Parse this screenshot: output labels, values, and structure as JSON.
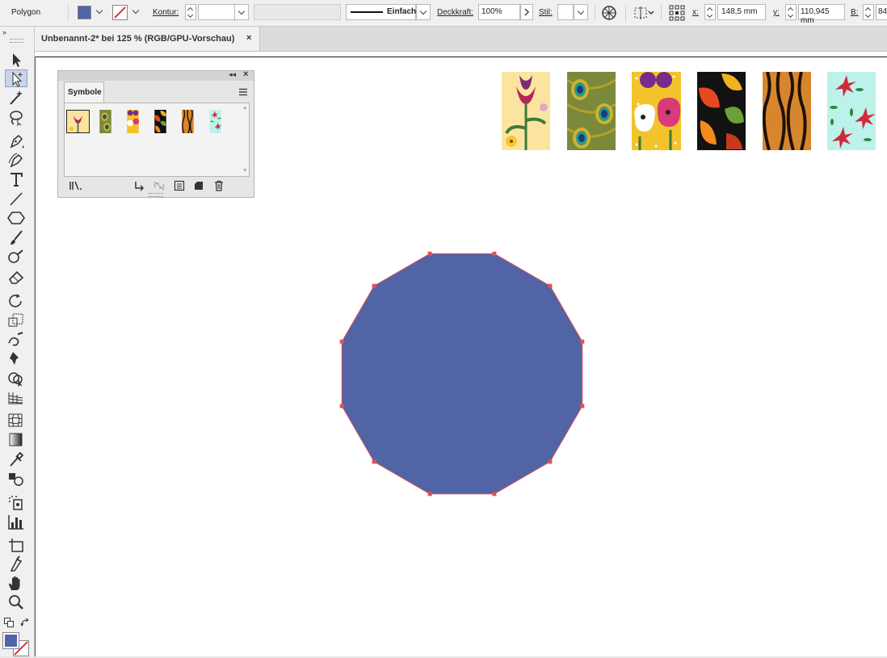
{
  "control_bar": {
    "object_type": "Polygon",
    "fill_color": "#5064a6",
    "stroke_label": "Kontur:",
    "stroke_style": "Einfach",
    "opacity_label": "Deckkraft:",
    "opacity_value": "100%",
    "style_label": "Stil:",
    "x_label": "x:",
    "x_value": "148,5 mm",
    "y_label": "y:",
    "y_value": "110,945 mm",
    "w_label": "B:",
    "w_value": "84"
  },
  "document_tab": {
    "title": "Unbenannt-2* bei 125 % (RGB/GPU-Vorschau)",
    "close": "×"
  },
  "symbols_panel": {
    "tab_label": "Symbole",
    "collapse": "◂◂",
    "close": "×",
    "thumbnails": [
      {
        "name": "lily",
        "selected": true
      },
      {
        "name": "peacock"
      },
      {
        "name": "pansy"
      },
      {
        "name": "autumn-leaves"
      },
      {
        "name": "tiger-stripes"
      },
      {
        "name": "poinsettia"
      }
    ]
  },
  "canvas": {
    "symbol_instances": [
      "lily",
      "peacock",
      "pansy",
      "autumn-leaves",
      "tiger-stripes",
      "poinsettia"
    ],
    "polygon": {
      "sides": 12,
      "fill": "#5064a6",
      "stroke": "#e0505a"
    }
  },
  "toolbar": {
    "fill_swatch": "#5064a6",
    "tools": [
      "selection",
      "direct-selection",
      "magic-wand",
      "lasso",
      "pen",
      "curvature",
      "type",
      "line",
      "polygon",
      "paintbrush",
      "blob-brush",
      "eraser",
      "rotate",
      "scale",
      "warp",
      "puppet-warp",
      "shape-builder",
      "perspective-grid",
      "mesh",
      "gradient",
      "eyedropper",
      "blend",
      "symbol-sprayer",
      "column-graph",
      "artboard",
      "slice",
      "hand",
      "zoom"
    ]
  }
}
